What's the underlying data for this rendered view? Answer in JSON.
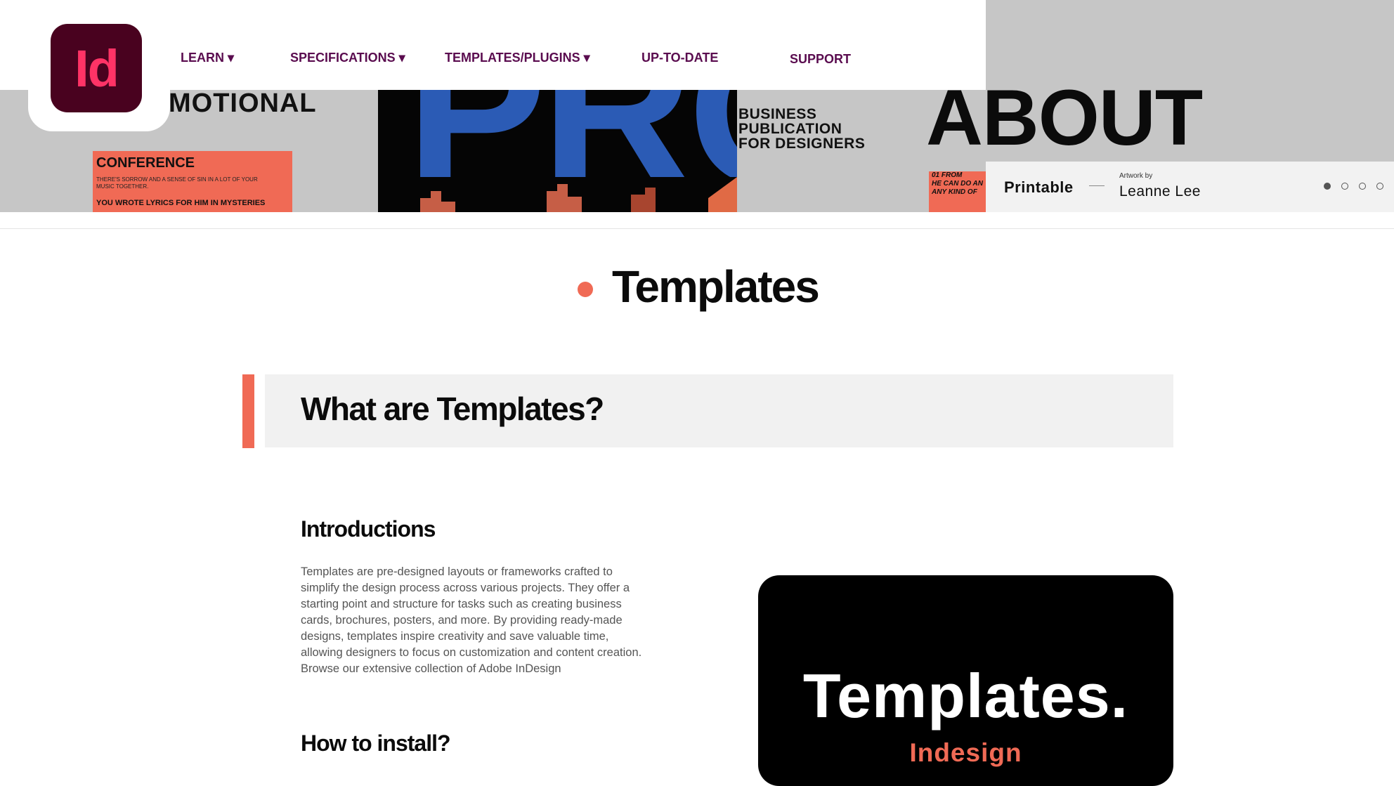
{
  "nav": {
    "logo_text": "Id",
    "items": [
      {
        "label": "LEARN ▾"
      },
      {
        "label": "SPECIFICATIONS ▾"
      },
      {
        "label": "TEMPLATES/PLUGINS ▾"
      },
      {
        "label": "UP-TO-DATE"
      },
      {
        "label": "SUPPORT"
      }
    ]
  },
  "banner": {
    "motional": "MOTIONAL",
    "conference_title": "CONFERENCE",
    "conference_body": "THERE'S SORROW AND A SENSE OF SIN IN A LOT OF YOUR MUSIC TOGETHER.",
    "conference_lyrics": "YOU WROTE LYRICS FOR HIM IN MYSTERIES",
    "pro": "PRO",
    "business_lines": [
      "BUSINESS",
      "PUBLICATION",
      "FOR DESIGNERS"
    ],
    "about": "ABOUT",
    "small_card_lines": [
      "01    FROM",
      "HE CAN DO AN",
      "ANY KIND OF"
    ],
    "caption": {
      "title": "Printable",
      "artwork_by": "Artwork by",
      "artist": "Leanne Lee"
    },
    "slides": {
      "count": 4,
      "active_index": 0
    }
  },
  "page_title": "Templates",
  "section": {
    "title": "What are Templates?"
  },
  "intro": {
    "heading": "Introductions",
    "text": "Templates are pre-designed layouts or frameworks crafted to simplify the design process across various projects. They offer a starting point and structure for tasks such as creating business cards, brochures, posters, and more. By providing ready-made designs, templates inspire creativity and save valuable time, allowing designers to focus on customization and content creation. Browse our extensive collection of Adobe InDesign"
  },
  "install": {
    "heading": "How to install?"
  },
  "promo": {
    "title": "Templates.",
    "subtitle": "Indesign"
  },
  "colors": {
    "accent": "#f06a55",
    "nav": "#5a0c4f",
    "logo_bg": "#49021f",
    "logo_fg": "#ff3366"
  }
}
